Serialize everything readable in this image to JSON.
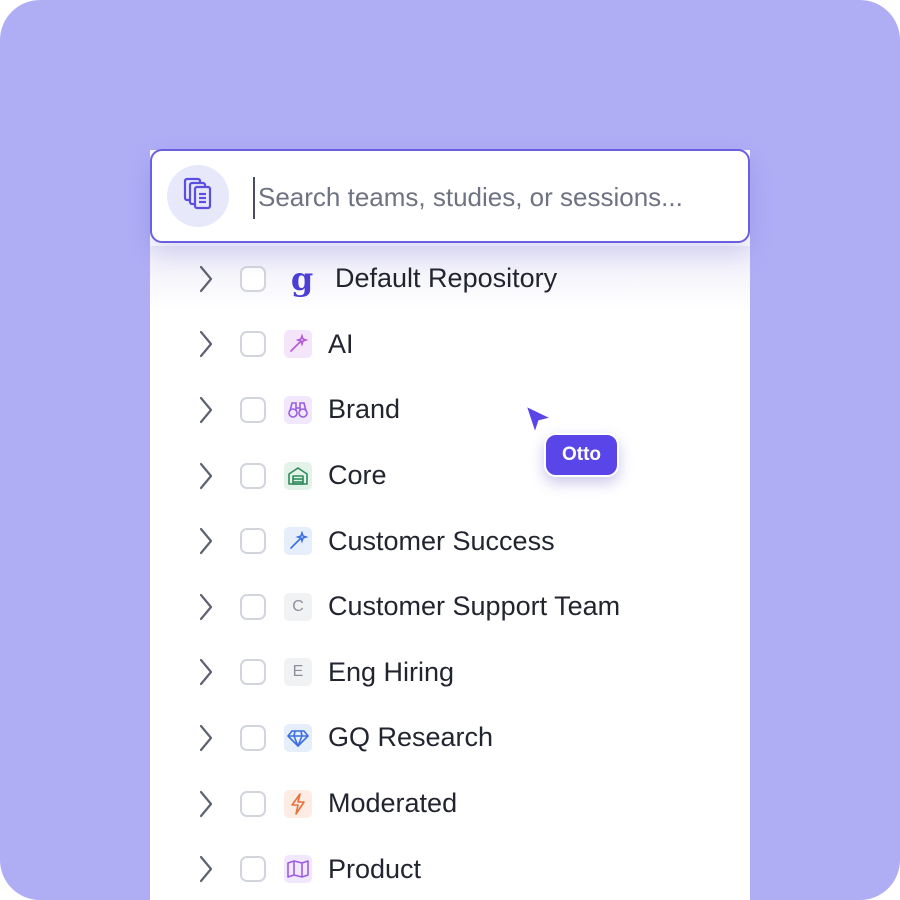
{
  "search": {
    "placeholder": "Search teams, studies, or sessions..."
  },
  "rows": [
    {
      "label": "Default Repository",
      "icon": "repository-logo-icon",
      "glyph": "g"
    },
    {
      "label": "AI",
      "icon": "magic-wand-icon"
    },
    {
      "label": "Brand",
      "icon": "binoculars-icon"
    },
    {
      "label": "Core",
      "icon": "warehouse-icon"
    },
    {
      "label": "Customer Success",
      "icon": "magic-wand-icon"
    },
    {
      "label": "Customer Support Team",
      "icon": "letter-icon",
      "glyph": "C"
    },
    {
      "label": "Eng Hiring",
      "icon": "letter-icon",
      "glyph": "E"
    },
    {
      "label": "GQ Research",
      "icon": "diamond-icon"
    },
    {
      "label": "Moderated",
      "icon": "lightning-icon"
    },
    {
      "label": "Product",
      "icon": "map-icon"
    }
  ],
  "collaborator": {
    "name": "Otto"
  },
  "colors": {
    "background": "#afaef5",
    "accent": "#5a45e8",
    "border": "#6b5ee0"
  }
}
